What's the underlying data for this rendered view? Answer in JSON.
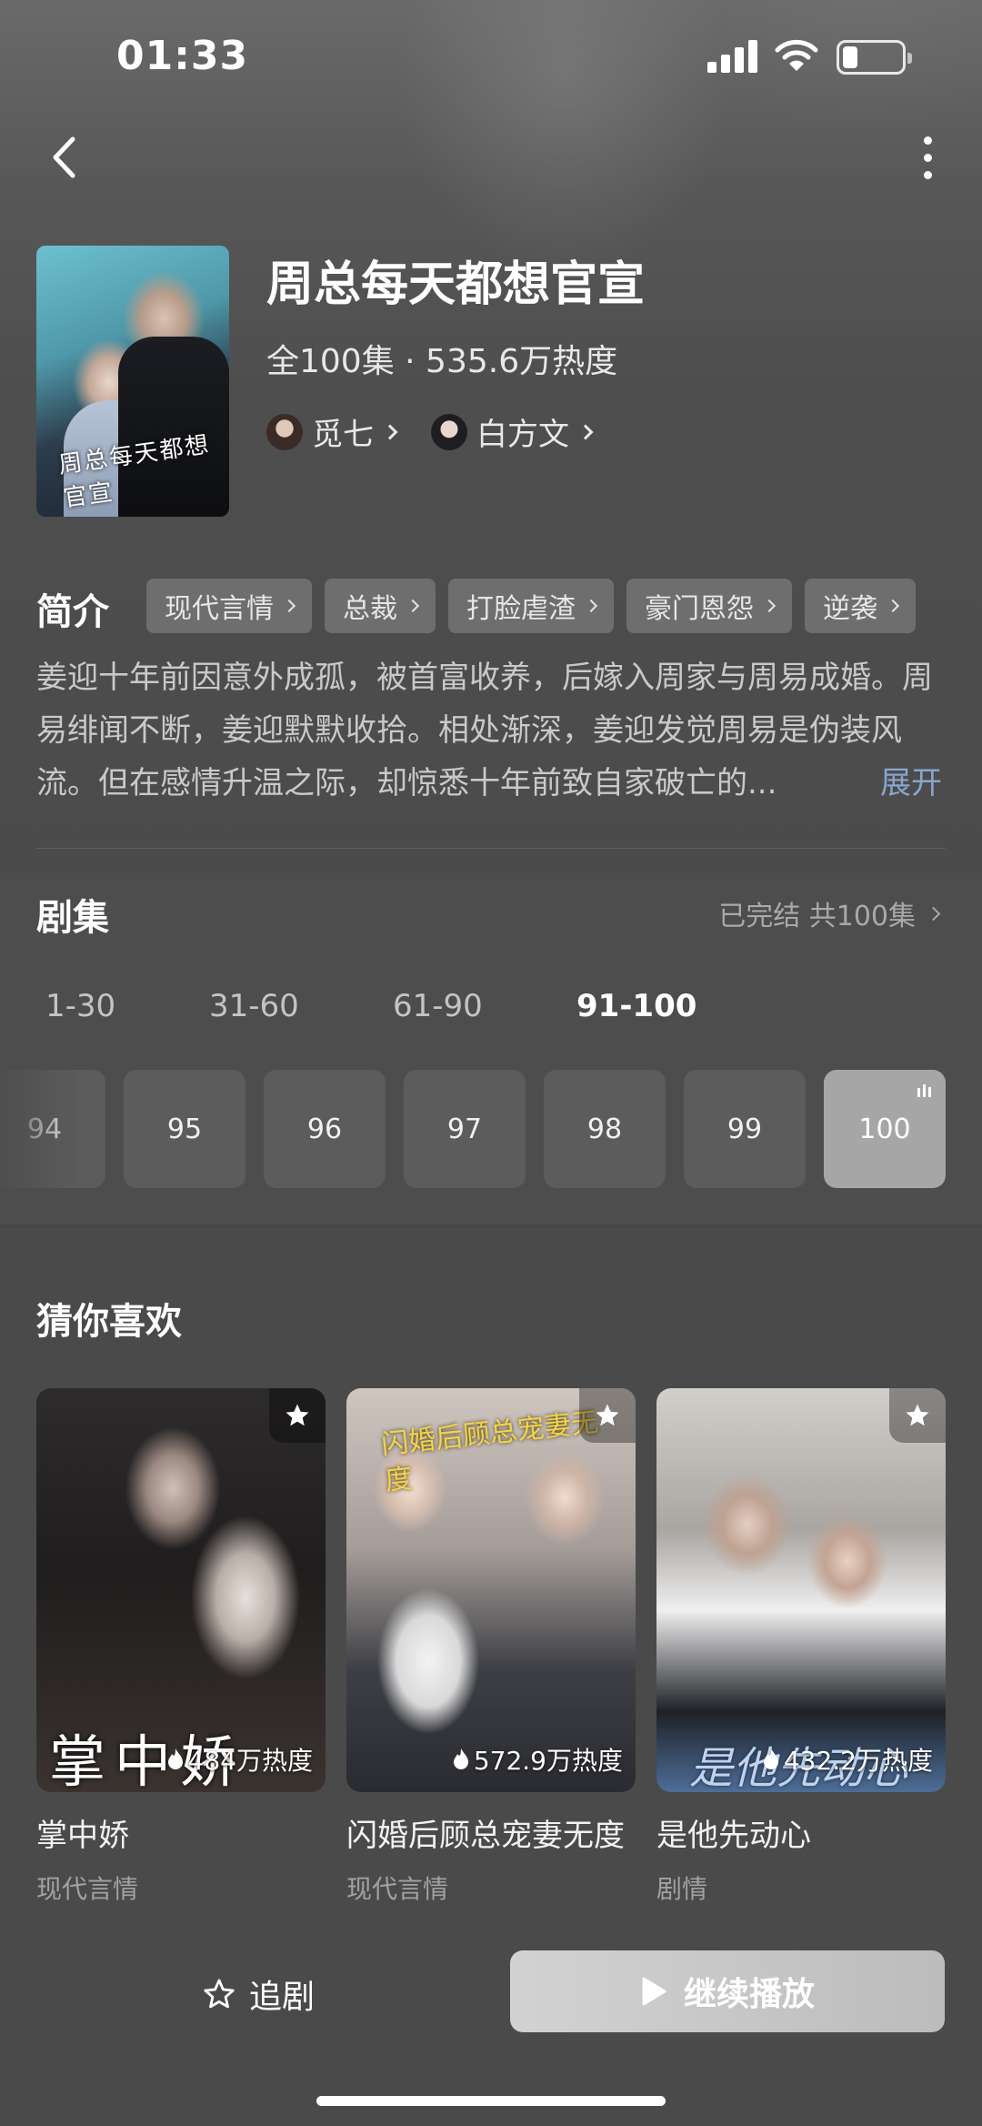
{
  "status_bar": {
    "time": "01:33",
    "battery_level": 0.25
  },
  "drama": {
    "title": "周总每天都想官宣",
    "poster_title": "周总每天都想官宣",
    "meta": "全100集 · 535.6万热度",
    "cast": [
      {
        "name": "觅七"
      },
      {
        "name": "白方文"
      }
    ]
  },
  "intro": {
    "label": "简介",
    "tags": [
      "现代言情",
      "总裁",
      "打脸虐渣",
      "豪门恩怨",
      "逆袭"
    ],
    "synopsis": "姜迎十年前因意外成孤，被首富收养，后嫁入周家与周易成婚。周易绯闻不断，姜迎默默收拾。相处渐深，姜迎发觉周易是伪装风流。但在感情升温之际，却惊悉十年前致自家破亡的...",
    "expand_label": "展开"
  },
  "episodes": {
    "label": "剧集",
    "status": "已完结 共100集",
    "ranges": [
      "1-30",
      "31-60",
      "61-90",
      "91-100"
    ],
    "active_range": "91-100",
    "items": [
      "94",
      "95",
      "96",
      "97",
      "98",
      "99",
      "100"
    ],
    "current": "100"
  },
  "recommend": {
    "label": "猜你喜欢",
    "items": [
      {
        "name": "掌中娇",
        "genre": "现代言情",
        "heat": "484万热度",
        "cover_text": "掌中娇"
      },
      {
        "name": "闪婚后顾总宠妻无度",
        "genre": "现代言情",
        "heat": "572.9万热度",
        "cover_text": "闪婚后顾总宠妻无度"
      },
      {
        "name": "是他先动心",
        "genre": "剧情",
        "heat": "432.2万热度",
        "cover_text": "是他先动心"
      }
    ]
  },
  "bottom_bar": {
    "follow_label": "追剧",
    "play_label": "继续播放"
  }
}
